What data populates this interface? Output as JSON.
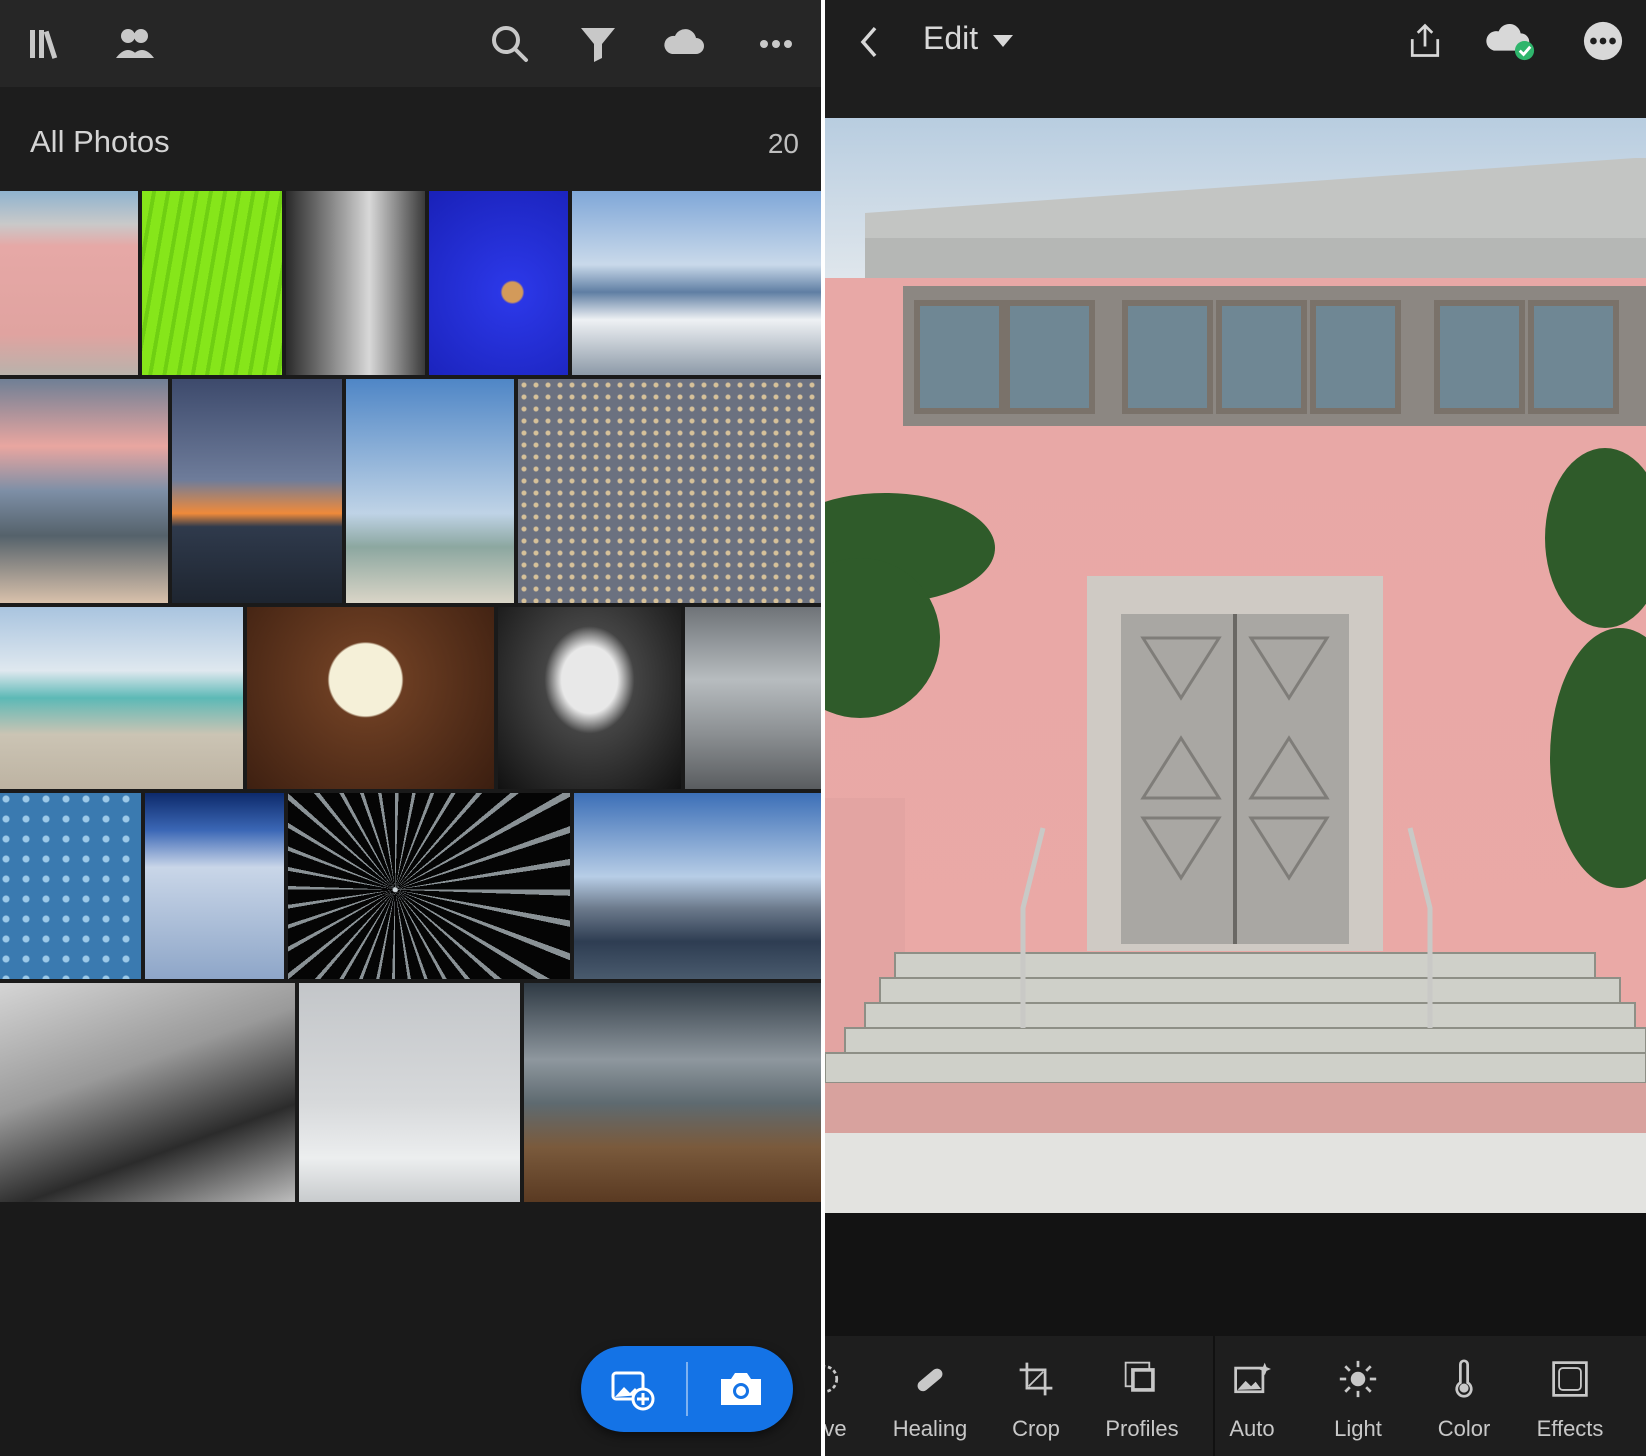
{
  "library": {
    "toolbar": {
      "icons": [
        "library-icon",
        "people-icon",
        "search-icon",
        "filter-icon",
        "cloud-icon",
        "more-icon"
      ]
    },
    "section_title": "All Photos",
    "photo_count": "20",
    "fab": {
      "icons": [
        "add-photo-icon",
        "camera-icon"
      ]
    }
  },
  "editor": {
    "mode_label": "Edit",
    "tools": [
      {
        "label": "ctive",
        "icon": "selective-icon"
      },
      {
        "label": "Healing",
        "icon": "healing-icon"
      },
      {
        "label": "Crop",
        "icon": "crop-icon"
      },
      {
        "label": "Profiles",
        "icon": "profiles-icon"
      },
      {
        "label": "Auto",
        "icon": "auto-icon"
      },
      {
        "label": "Light",
        "icon": "light-icon"
      },
      {
        "label": "Color",
        "icon": "color-icon"
      },
      {
        "label": "Effects",
        "icon": "effects-icon"
      }
    ],
    "colors": {
      "accent": "#1473e6",
      "sync_ok": "#2fb56c",
      "wall": "#e9a7a5"
    }
  }
}
